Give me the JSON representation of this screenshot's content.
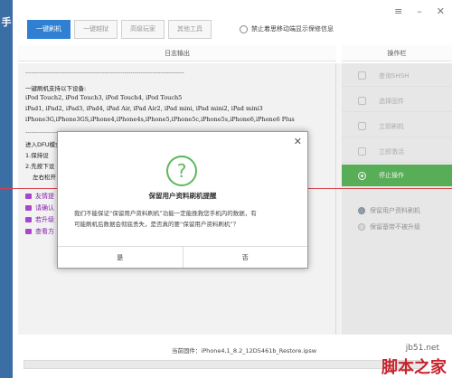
{
  "left_strip": {
    "glyph": "手"
  },
  "toolbar": {
    "buttons": [
      "一键刷机",
      "一键越狱",
      "高级玩家",
      "其他工具"
    ],
    "option_label": "禁止着思移动端显示保修信息"
  },
  "headers": {
    "log": "日志输出",
    "ops": "操作栏"
  },
  "log_lines": [
    "--------------------------------------------------------------------------------",
    "一键刷机支持以下设备:",
    "iPod Touch2, iPod Touch3, iPod Touch4, iPod Touch5",
    "iPad1, iPad2, iPad3, iPad4, iPad Air, iPad Air2, iPad mini, iPad mini2, iPad mini3",
    "iPhone3G,iPhone3GS,iPhone4,iPhone4s,iPhone5,iPhone5c,iPhone5s,iPhone6,iPhone6 Plus",
    "--------------------------------------------------------------------------------",
    "进入DFU模式",
    "1.保持设",
    "2.先按下设",
    "左右松开"
  ],
  "log_purple": [
    "友情提",
    "请确认",
    "若升级",
    "查看方"
  ],
  "ops": {
    "items": [
      "查询SHSH",
      "选择固件",
      "立即刷机",
      "立即激活",
      "停止操作"
    ],
    "checks": [
      "保留用户资料刷机",
      "保留基带不被升级"
    ]
  },
  "dialog": {
    "title": "保留用户资料刷机提醒",
    "message_1": "我们不能保证“保留用户资料刷机”功能一定能挽救您手机内的数据，有",
    "message_2": "可能刷机后数据会彻底丢失，是否真的要“保留用户资料刷机”？",
    "yes": "是",
    "no": "否"
  },
  "footer": {
    "firmware": "当前固件：iPhone4,1_8.2_12D5461b_Restore.ipsw",
    "watermark_url": "jb51.net",
    "watermark_brand": "脚本之家"
  }
}
